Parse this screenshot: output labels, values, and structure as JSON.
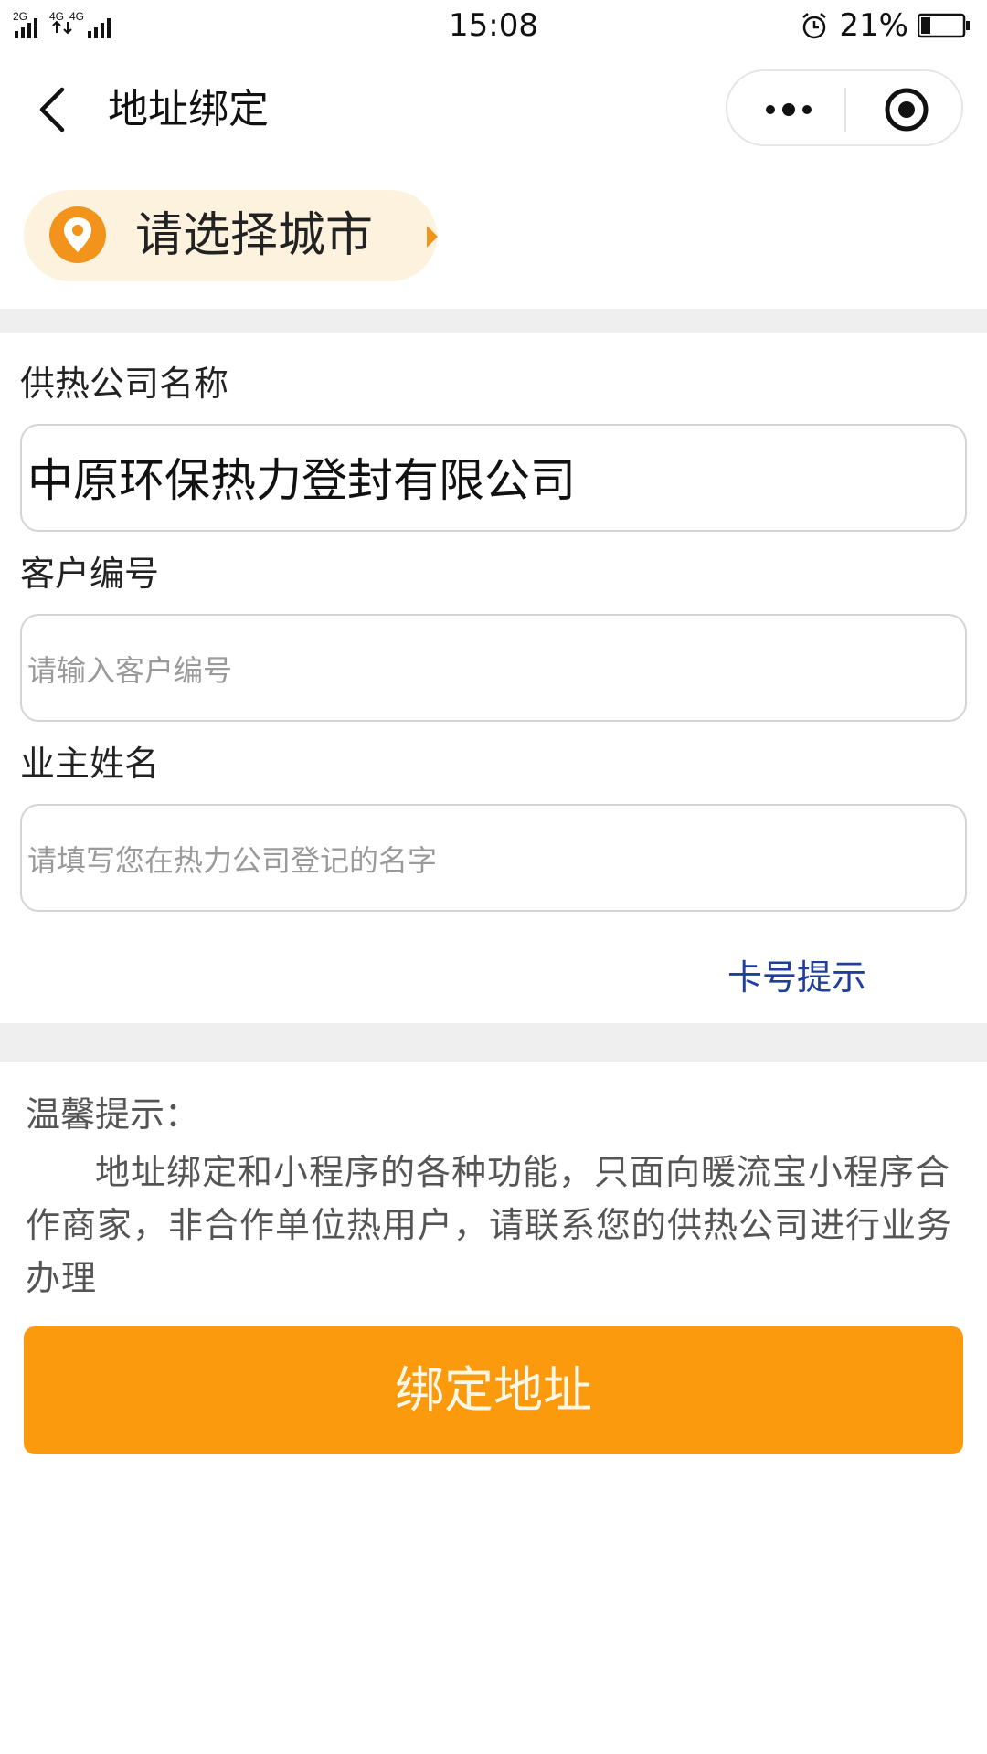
{
  "status_bar": {
    "network": "2G 4G 4G",
    "time": "15:08",
    "battery": "21%"
  },
  "nav": {
    "title": "地址绑定"
  },
  "city": {
    "label": "请选择城市"
  },
  "form": {
    "company": {
      "label": "供热公司名称",
      "value": "中原环保热力登封有限公司"
    },
    "customer_no": {
      "label": "客户编号",
      "placeholder": "请输入客户编号"
    },
    "owner_name": {
      "label": "业主姓名",
      "placeholder": "请填写您在热力公司登记的名字"
    },
    "card_hint": "卡号提示"
  },
  "tips": {
    "title": "温馨提示：",
    "body": "地址绑定和小程序的各种功能，只面向暖流宝小程序合作商家，非合作单位热用户，请联系您的供热公司进行业务办理"
  },
  "actions": {
    "bind_label": "绑定地址"
  },
  "colors": {
    "accent": "#fa9a0c",
    "pill_bg": "#fdf2dd",
    "link": "#1f3f9a",
    "band": "#efefef"
  }
}
